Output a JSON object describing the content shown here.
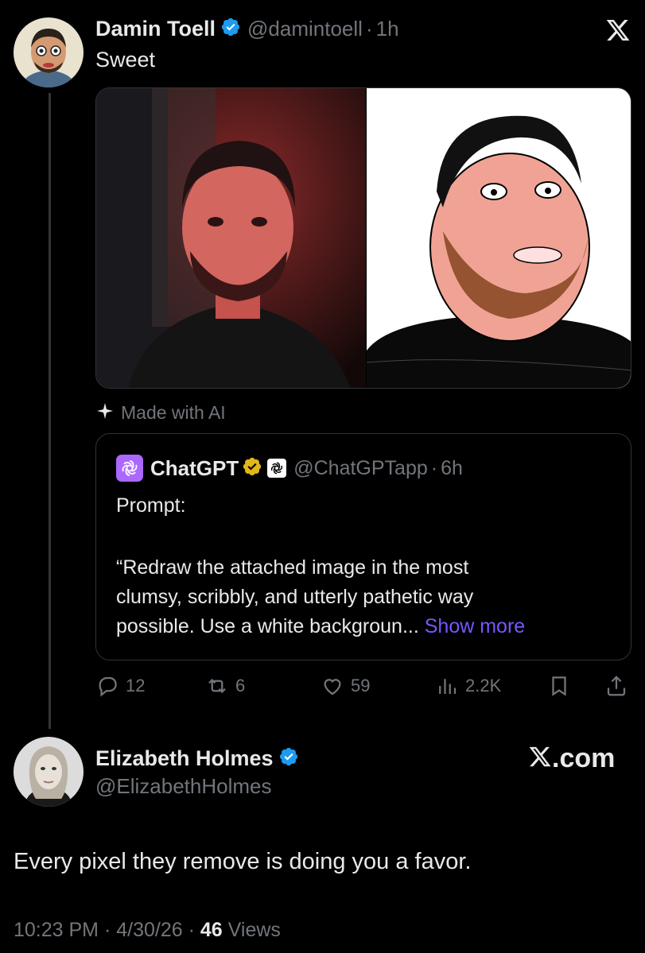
{
  "tweet": {
    "author_name": "Damin Toell",
    "handle": "@damintoell",
    "time": "1h",
    "text": "Sweet",
    "made_with_ai": "Made with AI"
  },
  "quote": {
    "author_name": "ChatGPT",
    "handle": "@ChatGPTapp",
    "time": "6h",
    "line1": "Prompt:",
    "body_line1": "“Redraw the attached image in the most",
    "body_line2": "clumsy, scribbly, and utterly pathetic way",
    "body_line3": "possible. Use a white backgroun",
    "ellipsis": "...",
    "show_more": "Show more"
  },
  "actions": {
    "replies": "12",
    "reposts": "6",
    "likes": "59",
    "views": "2.2K"
  },
  "reply": {
    "author_name": "Elizabeth Holmes",
    "handle": "@ElizabethHolmes",
    "brand": "X.com",
    "text": "Every pixel they remove is doing you a favor.",
    "timestamp": "10:23 PM",
    "date": "4/30/26",
    "views_count": "46",
    "views_label": "Views"
  },
  "colors": {
    "background": "#000000",
    "text": "#e7e9ea",
    "muted": "#71767b",
    "link": "#7856ff",
    "verified_blue": "#1d9bf0",
    "verified_gold": "#e2b719",
    "chatgpt_purple": "#ab68ff"
  },
  "icons": [
    "x-logo-icon",
    "verified-badge-icon",
    "sparkle-icon",
    "openai-icon",
    "reply-icon",
    "repost-icon",
    "like-icon",
    "views-icon",
    "bookmark-icon",
    "share-icon"
  ]
}
